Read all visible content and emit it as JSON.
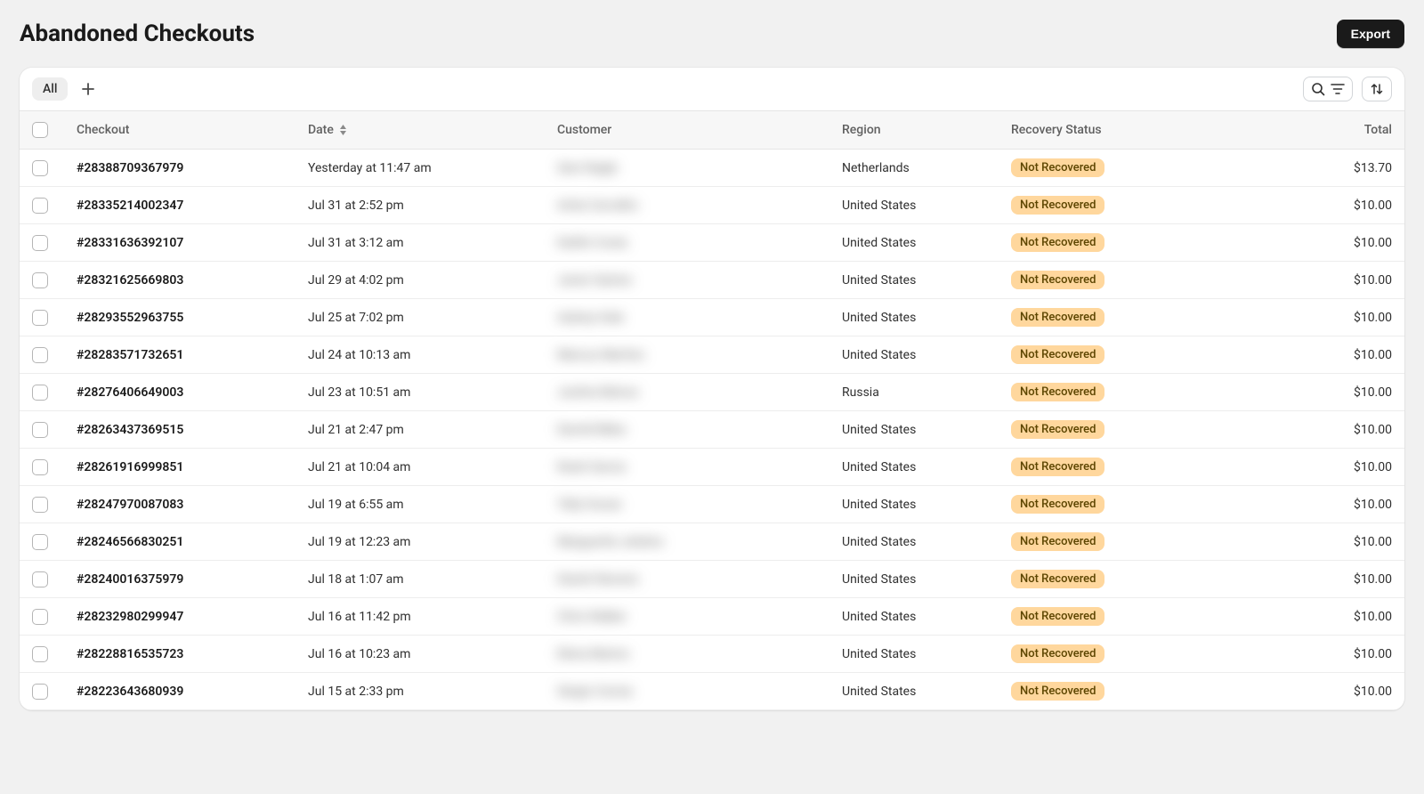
{
  "header": {
    "title": "Abandoned Checkouts",
    "export_label": "Export"
  },
  "tabs": {
    "active": "All"
  },
  "columns": {
    "checkout": "Checkout",
    "date": "Date",
    "customer": "Customer",
    "region": "Region",
    "recovery_status": "Recovery Status",
    "total": "Total"
  },
  "status_label": "Not Recovered",
  "rows": [
    {
      "id": "#28388709367979",
      "date": "Yesterday at 11:47 am",
      "customer": "Sam Nagle",
      "region": "Netherlands",
      "status": "Not Recovered",
      "total": "$13.70"
    },
    {
      "id": "#28335214002347",
      "date": "Jul 31 at 2:52 pm",
      "customer": "Anita Carvalho",
      "region": "United States",
      "status": "Not Recovered",
      "total": "$10.00"
    },
    {
      "id": "#28331636392107",
      "date": "Jul 31 at 3:12 am",
      "customer": "Kaitlin Costa",
      "region": "United States",
      "status": "Not Recovered",
      "total": "$10.00"
    },
    {
      "id": "#28321625669803",
      "date": "Jul 29 at 4:02 pm",
      "customer": "Javier Santos",
      "region": "United States",
      "status": "Not Recovered",
      "total": "$10.00"
    },
    {
      "id": "#28293552963755",
      "date": "Jul 25 at 7:02 pm",
      "customer": "Aubrey Hale",
      "region": "United States",
      "status": "Not Recovered",
      "total": "$10.00"
    },
    {
      "id": "#28283571732651",
      "date": "Jul 24 at 10:13 am",
      "customer": "Marcus Martins",
      "region": "United States",
      "status": "Not Recovered",
      "total": "$10.00"
    },
    {
      "id": "#28276406649003",
      "date": "Jul 23 at 10:51 am",
      "customer": "Justine Belova",
      "region": "Russia",
      "status": "Not Recovered",
      "total": "$10.00"
    },
    {
      "id": "#28263437369515",
      "date": "Jul 21 at 2:47 pm",
      "customer": "Darrell Miles",
      "region": "United States",
      "status": "Not Recovered",
      "total": "$10.00"
    },
    {
      "id": "#28261916999851",
      "date": "Jul 21 at 10:04 am",
      "customer": "Noah Garcia",
      "region": "United States",
      "status": "Not Recovered",
      "total": "$10.00"
    },
    {
      "id": "#28247970087083",
      "date": "Jul 19 at 6:55 am",
      "customer": "Telly House",
      "region": "United States",
      "status": "Not Recovered",
      "total": "$10.00"
    },
    {
      "id": "#28246566830251",
      "date": "Jul 19 at 12:23 am",
      "customer": "Marguerite Jenkins",
      "region": "United States",
      "status": "Not Recovered",
      "total": "$10.00"
    },
    {
      "id": "#28240016375979",
      "date": "Jul 18 at 1:07 am",
      "customer": "Daniel Stevens",
      "region": "United States",
      "status": "Not Recovered",
      "total": "$10.00"
    },
    {
      "id": "#28232980299947",
      "date": "Jul 16 at 11:42 pm",
      "customer": "Chris Walker",
      "region": "United States",
      "status": "Not Recovered",
      "total": "$10.00"
    },
    {
      "id": "#28228816535723",
      "date": "Jul 16 at 10:23 am",
      "customer": "Elena Marino",
      "region": "United States",
      "status": "Not Recovered",
      "total": "$10.00"
    },
    {
      "id": "#28223643680939",
      "date": "Jul 15 at 2:33 pm",
      "customer": "Sergio Correa",
      "region": "United States",
      "status": "Not Recovered",
      "total": "$10.00"
    }
  ]
}
